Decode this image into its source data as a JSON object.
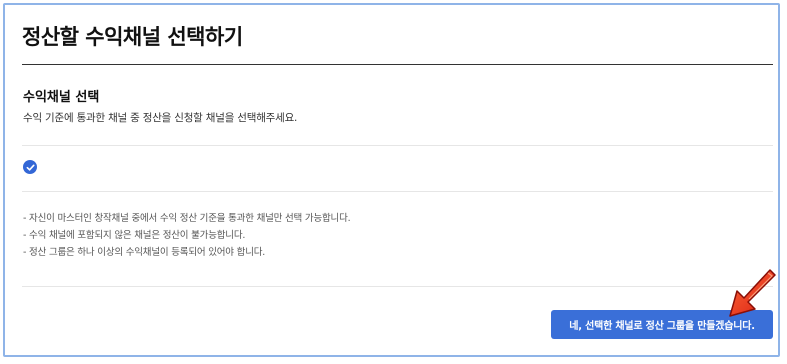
{
  "page": {
    "title": "정산할 수익채널 선택하기"
  },
  "section": {
    "title": "수익채널 선택",
    "description": "수익 기준에 통과한 채널 중 정산을 신청할 채널을 선택해주세요."
  },
  "selection": {
    "checked": true,
    "icon": "check-circle-icon"
  },
  "notes": [
    "- 자신이 마스터인 창작채널 중에서 수익 정산 기준을 통과한 채널만 선택 가능합니다.",
    "- 수익 채널에 포함되지 않은 채널은 정산이 불가능합니다.",
    "- 정산 그룹은 하나 이상의 수익채널이 등록되어 있어야 합니다."
  ],
  "actions": {
    "confirm_label": "네, 선택한 채널로 정산 그룹을 만들겠습니다."
  },
  "colors": {
    "accent": "#3a6fd8",
    "frame_border": "#8fb4e8",
    "arrow": "#e8321e"
  }
}
